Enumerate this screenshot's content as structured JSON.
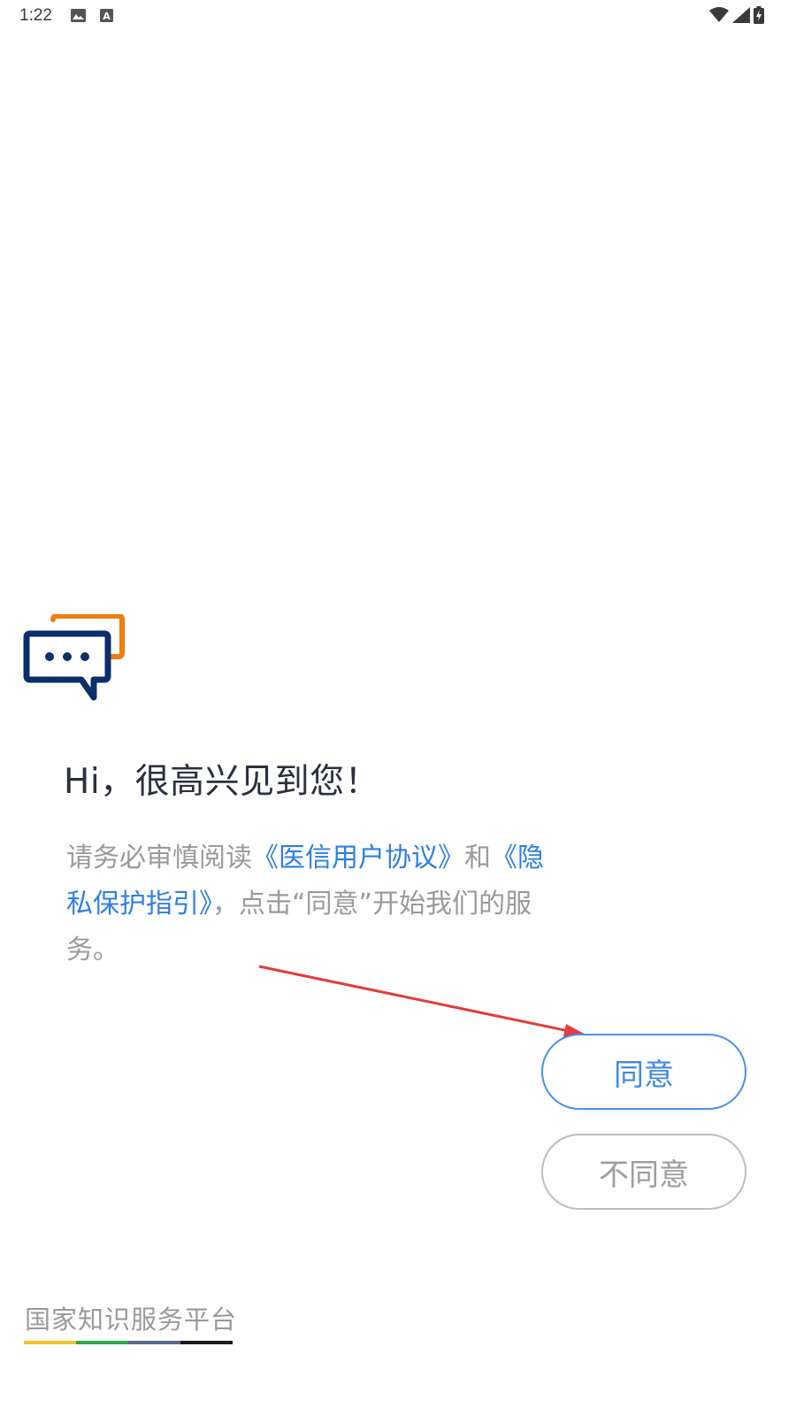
{
  "status_bar": {
    "time": "1:22",
    "left_icons": [
      "image-icon",
      "keyboard-a-icon"
    ],
    "right_icons": [
      "wifi-icon",
      "signal-icon",
      "battery-charging-icon"
    ]
  },
  "logo": {
    "icon": "chat-bubbles-icon",
    "colors": {
      "front": "#0c2f6b",
      "back": "#ef7d10"
    }
  },
  "greeting": "Hi，很高兴见到您！",
  "consent": {
    "prefix": "请务必审慎阅读",
    "user_agreement": "《医信用户协议》",
    "and": "和",
    "privacy_guide": "《隐私保护指引》",
    "suffix": "，点击“同意”开始我们的服务。"
  },
  "buttons": {
    "agree": "同意",
    "disagree": "不同意"
  },
  "footer": {
    "platform_name": "国家知识服务平台",
    "bar_colors": [
      "#f2c12e",
      "#2aa748",
      "#5a6a8a",
      "#1a1a1a"
    ]
  },
  "colors": {
    "link": "#2f7fe0",
    "agree_border": "#4a90e8",
    "disagree_border": "#bdbdbd",
    "annotation_arrow": "#e23c3c"
  }
}
